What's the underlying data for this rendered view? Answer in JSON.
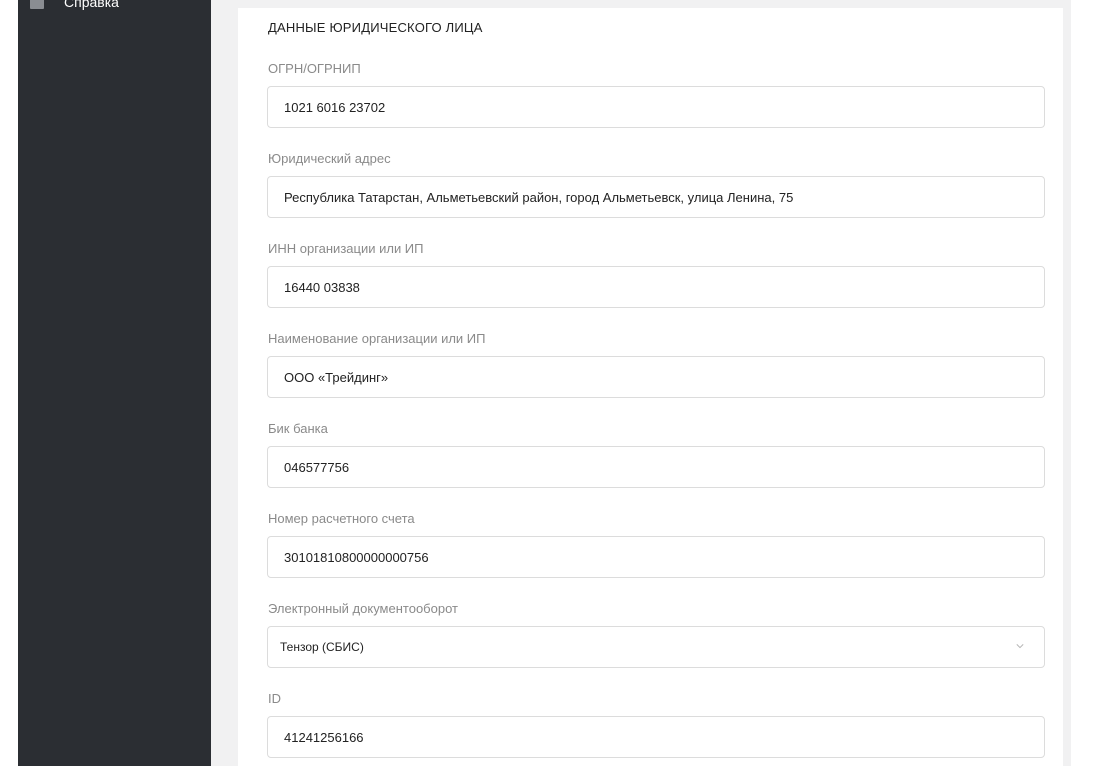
{
  "sidebar": {
    "items": [
      {
        "label": "Справка",
        "icon": "help-icon"
      }
    ]
  },
  "section": {
    "title": "ДАННЫЕ ЮРИДИЧЕСКОГО ЛИЦА"
  },
  "fields": {
    "ogrn": {
      "label": "ОГРН/ОГРНИП",
      "value": "1021 6016 23702"
    },
    "legal_address": {
      "label": "Юридический адрес",
      "value": "Республика Татарстан, Альметьевский район, город Альметьевск, улица Ленина, 75"
    },
    "inn": {
      "label": "ИНН организации или ИП",
      "value": "16440 03838"
    },
    "org_name": {
      "label": "Наименование организации или ИП",
      "value": "ООО «Трейдинг»"
    },
    "bik": {
      "label": "Бик банка",
      "value": "046577756"
    },
    "account": {
      "label": "Номер расчетного счета",
      "value": "30101810800000000756"
    },
    "edo": {
      "label": "Электронный документооборот",
      "value": "Тензор (СБИС)"
    },
    "id": {
      "label": "ID",
      "value": "41241256166"
    }
  },
  "colors": {
    "sidebar_bg": "#2b2e33",
    "content_bg": "#f1f1f2",
    "border": "#dcdcdc",
    "label": "#8a8a8a"
  }
}
